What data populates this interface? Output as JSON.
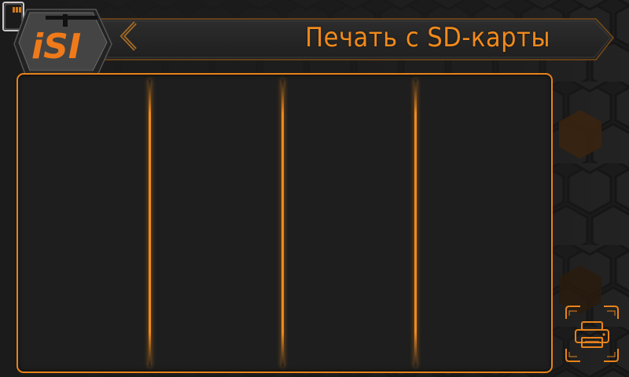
{
  "header": {
    "title": "Печать с SD-карты",
    "back_icon": "chevron-left-icon",
    "storage_icon": "sd-card-icon"
  },
  "logo": {
    "text": "iSI"
  },
  "file_list": {
    "columns": [
      "",
      "",
      "",
      ""
    ]
  },
  "actions": {
    "print_icon": "printer-icon"
  },
  "colors": {
    "accent": "#f08a1c",
    "background": "#1b1b1b",
    "panel": "#1e1e1e",
    "hex_highlight": "#3a2410"
  }
}
